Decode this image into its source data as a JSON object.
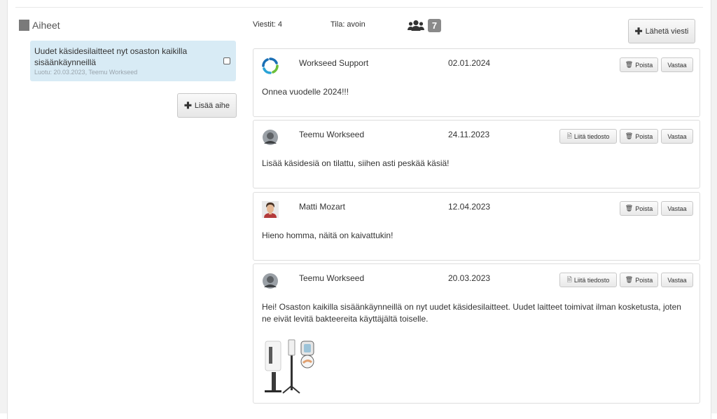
{
  "topics": {
    "header": "Aiheet",
    "items": [
      {
        "title": "Uudet käsidesilaitteet nyt osaston kaikilla sisäänkäynneillä",
        "meta": "Luotu: 20.03.2023, Teemu Workseed"
      }
    ],
    "add_label": "Lisää aihe"
  },
  "status": {
    "messages": "Viestit: 4",
    "state": "Tila: avoin",
    "participants": "7",
    "send_label": "Lähetä viesti"
  },
  "messages": [
    {
      "author": "Workseed Support",
      "date": "02.01.2024",
      "body": "Onnea vuodelle 2024!!!",
      "avatar": "workseed-logo-icon"
    },
    {
      "author": "Teemu Workseed",
      "date": "24.11.2023",
      "body": "Lisää käsidesiä on tilattu, siihen asti peskää käsiä!",
      "avatar": "user-avatar"
    },
    {
      "author": "Matti Mozart",
      "date": "12.04.2023",
      "body": "Hieno homma, näitä on kaivattukin!",
      "avatar": "user-avatar"
    },
    {
      "author": "Teemu Workseed",
      "date": "20.03.2023",
      "body": "Hei! Osaston kaikilla sisäänkäynneillä on nyt uudet käsidesilaitteet. Uudet laitteet toimivat ilman kosketusta, joten ne eivät levitä bakteereita käyttäjältä toiselle.",
      "avatar": "user-avatar"
    }
  ],
  "actions": {
    "attach": "Liitä tiedosto",
    "delete": "Poista",
    "reply": "Vastaa"
  },
  "colors": {
    "selected_topic_bg": "#d8ebf5",
    "badge_bg": "#8a8a8a"
  }
}
